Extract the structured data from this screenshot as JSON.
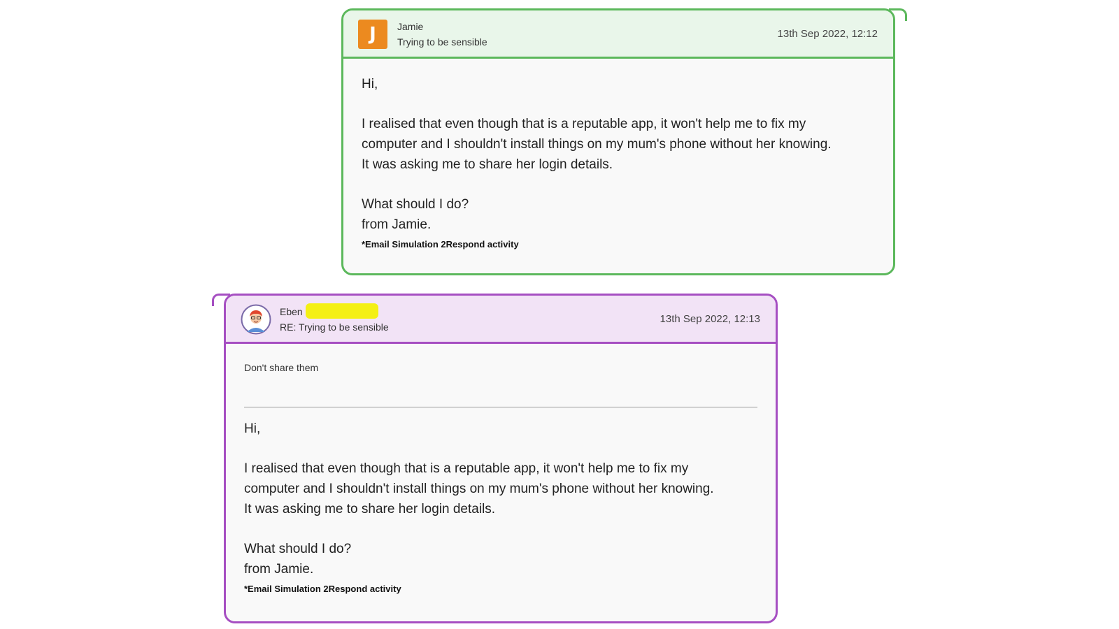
{
  "messages": [
    {
      "sender": "Jamie",
      "avatar_letter": "J",
      "subject": "Trying to be sensible",
      "time": "13th Sep 2022, 12:12",
      "body": {
        "greeting": "Hi,",
        "line1": "I realised that even though that is a reputable app, it won't help me to fix my",
        "line2": "computer and I shouldn't install things on my mum's phone without her knowing.",
        "line3": "It was asking me to share her login details.",
        "question": "What should I do?",
        "signoff": "from Jamie.",
        "footnote": "*Email Simulation 2Respond activity"
      }
    },
    {
      "sender": "Eben",
      "subject": "RE: Trying to be sensible",
      "time": "13th Sep 2022, 12:13",
      "reply": "Don't share them",
      "quoted": {
        "greeting": "Hi,",
        "line1": "I realised that even though that is a reputable app, it won't help me to fix my",
        "line2": "computer and I shouldn't install things on my mum's phone without her knowing.",
        "line3": "It was asking me to share her login details.",
        "question": "What should I do?",
        "signoff": "from Jamie.",
        "footnote": "*Email Simulation 2Respond activity"
      }
    }
  ],
  "colors": {
    "incoming_border": "#5cb85c",
    "incoming_header": "#e9f6ea",
    "outgoing_border": "#a64fc2",
    "outgoing_header": "#f2e3f6",
    "avatar_j": "#ec8a1f",
    "redaction": "#f4f014"
  },
  "icons": {
    "incoming_avatar": "letter-avatar",
    "outgoing_avatar": "cartoon-person-avatar"
  }
}
